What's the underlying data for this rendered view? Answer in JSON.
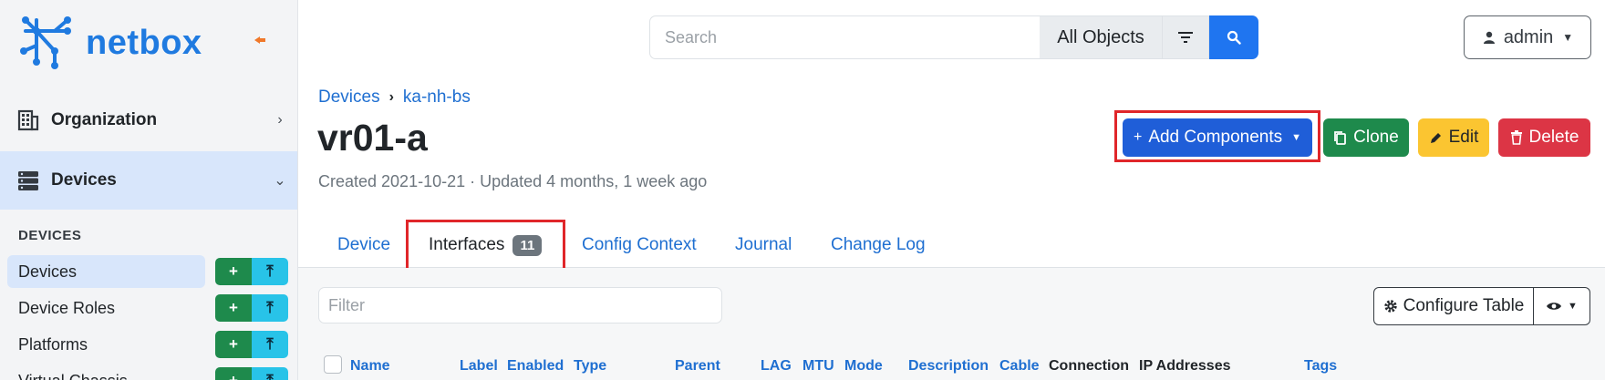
{
  "sidebar": {
    "logo_text": "netbox",
    "sections": {
      "organization": "Organization",
      "devices": "Devices"
    },
    "group_heading": "DEVICES",
    "items": [
      {
        "label": "Devices"
      },
      {
        "label": "Device Roles"
      },
      {
        "label": "Platforms"
      },
      {
        "label": "Virtual Chassis"
      }
    ],
    "add_glyph": "+",
    "import_glyph": "⤒"
  },
  "search": {
    "placeholder": "Search",
    "scope": "All Objects"
  },
  "user": {
    "label": "admin"
  },
  "breadcrumb": [
    "Devices",
    "ka-nh-bs"
  ],
  "page": {
    "title": "vr01-a",
    "meta": "Created 2021-10-21 · Updated 4 months, 1 week ago"
  },
  "actions": {
    "add_components": "Add Components",
    "clone": "Clone",
    "edit": "Edit",
    "delete": "Delete"
  },
  "tabs": [
    {
      "label": "Device"
    },
    {
      "label": "Interfaces",
      "badge": "11"
    },
    {
      "label": "Config Context"
    },
    {
      "label": "Journal"
    },
    {
      "label": "Change Log"
    }
  ],
  "table_controls": {
    "filter_placeholder": "Filter",
    "configure_table": "Configure Table"
  },
  "table_columns": [
    "Name",
    "Label",
    "Enabled",
    "Type",
    "Parent",
    "LAG",
    "MTU",
    "Mode",
    "Description",
    "Cable",
    "Connection",
    "IP Addresses",
    "Tags"
  ],
  "colors": {
    "accent": "#1f75f0",
    "success": "#1e8a4c",
    "warning": "#fbc531",
    "danger": "#dc3545",
    "highlight": "#e0262a"
  }
}
